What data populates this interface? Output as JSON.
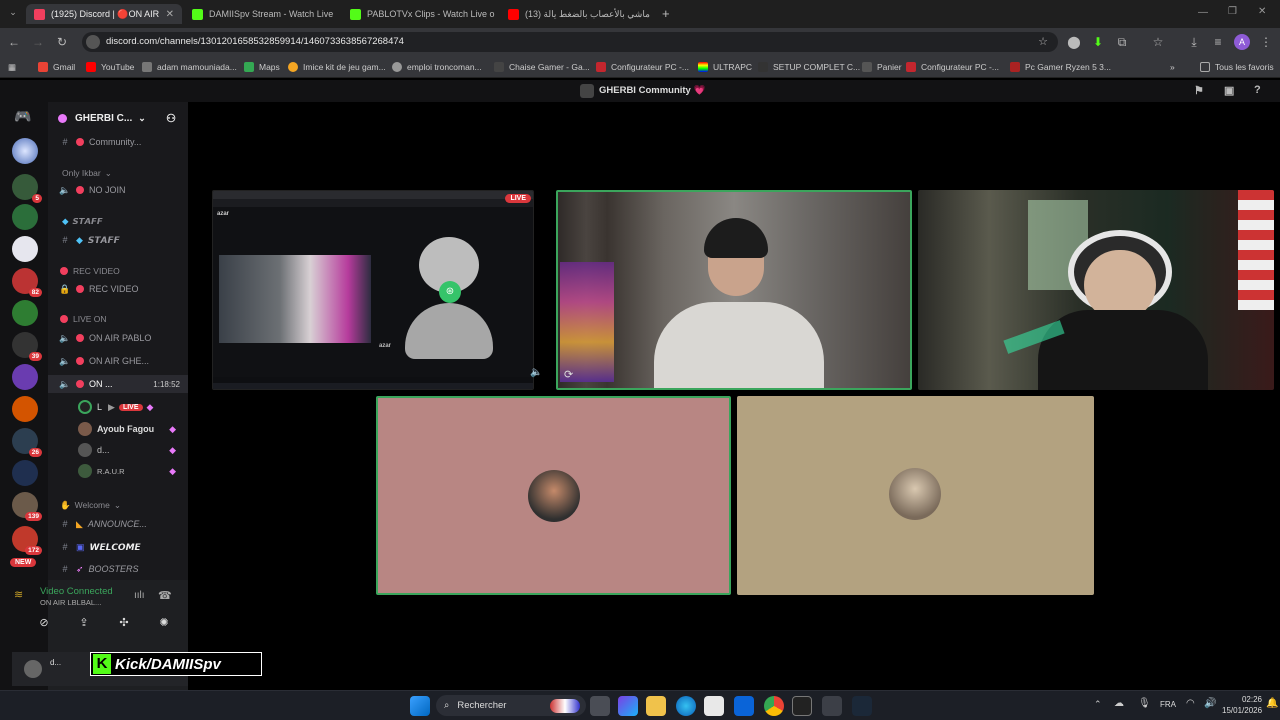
{
  "browser": {
    "tabs": [
      {
        "label": "(1925) Discord | 🔴ON AIR",
        "color": "#f23f5e"
      },
      {
        "label": "DAMIISpv Stream - Watch Live",
        "color": "#53fc18"
      },
      {
        "label": "PABLOTVx Clips - Watch Live o",
        "color": "#53fc18"
      },
      {
        "label": "(13) ماشي بالأعصاب بالضغط يالة",
        "color": "#ff0000"
      }
    ],
    "url": "discord.com/channels/1301201658532859914/1460733638567268474",
    "bookmarks": [
      "Gmail",
      "YouTube",
      "adam mamouniada...",
      "Maps",
      "Imice kit de jeu gam...",
      "emploi troncoman...",
      "Chaise Gamer - Ga...",
      "Configurateur PC -...",
      "ULTRAPC",
      "SETUP COMPLET C...",
      "Panier",
      "Configurateur PC -...",
      "Pc Gamer Ryzen 5 3..."
    ],
    "all_bookmarks": "Tous les favoris"
  },
  "discord": {
    "window_title": "GHERBI Community 💗",
    "server_name": "GHERBI C...",
    "channels": {
      "community": "Community...",
      "cat_only": "Only Ikbar",
      "no_join": "NO JOIN",
      "cat_staff": "𝙎𝙏𝘼𝙁𝙁",
      "staff": "𝙎𝙏𝘼𝙁𝙁",
      "cat_rec": "REC VIDEO",
      "rec": "REC VIDEO",
      "cat_live": "LIVE ON",
      "on_air_pablo": "ON AIR PABLO",
      "on_air_ghe": "ON AIR GHE...",
      "on_active": "ON ...",
      "timer": "1:18:52",
      "cat_welcome": "Welcome",
      "announce": "ANNOUNCE...",
      "welcome": "𝙒𝙀𝙇𝘾𝙊𝙈𝙀",
      "boosters": "BOOSTERS"
    },
    "voice_users": {
      "user1": "L",
      "live": "LIVE",
      "user2": "Ayoub Fagou",
      "user3": "d...",
      "user4": "R.A.U.R"
    },
    "voice_status": {
      "connected": "Video Connected",
      "channel": "ON AIR LBLBAL..."
    },
    "user_name": "d...",
    "overlay_text": "Kick/DAMIISpv",
    "server_badges": [
      "5",
      "82",
      "39",
      "26",
      "139",
      "172"
    ],
    "new_label": "NEW",
    "stage_live": "LIVE",
    "screen_share_brand": "azar"
  },
  "taskbar": {
    "search": "Rechercher",
    "lang": "FRA",
    "time": "02:26",
    "date": "15/01/2026"
  },
  "colors": {
    "tile_rose": "#b88683",
    "tile_tan": "#b3a280",
    "speaking": "#3ba55c"
  }
}
